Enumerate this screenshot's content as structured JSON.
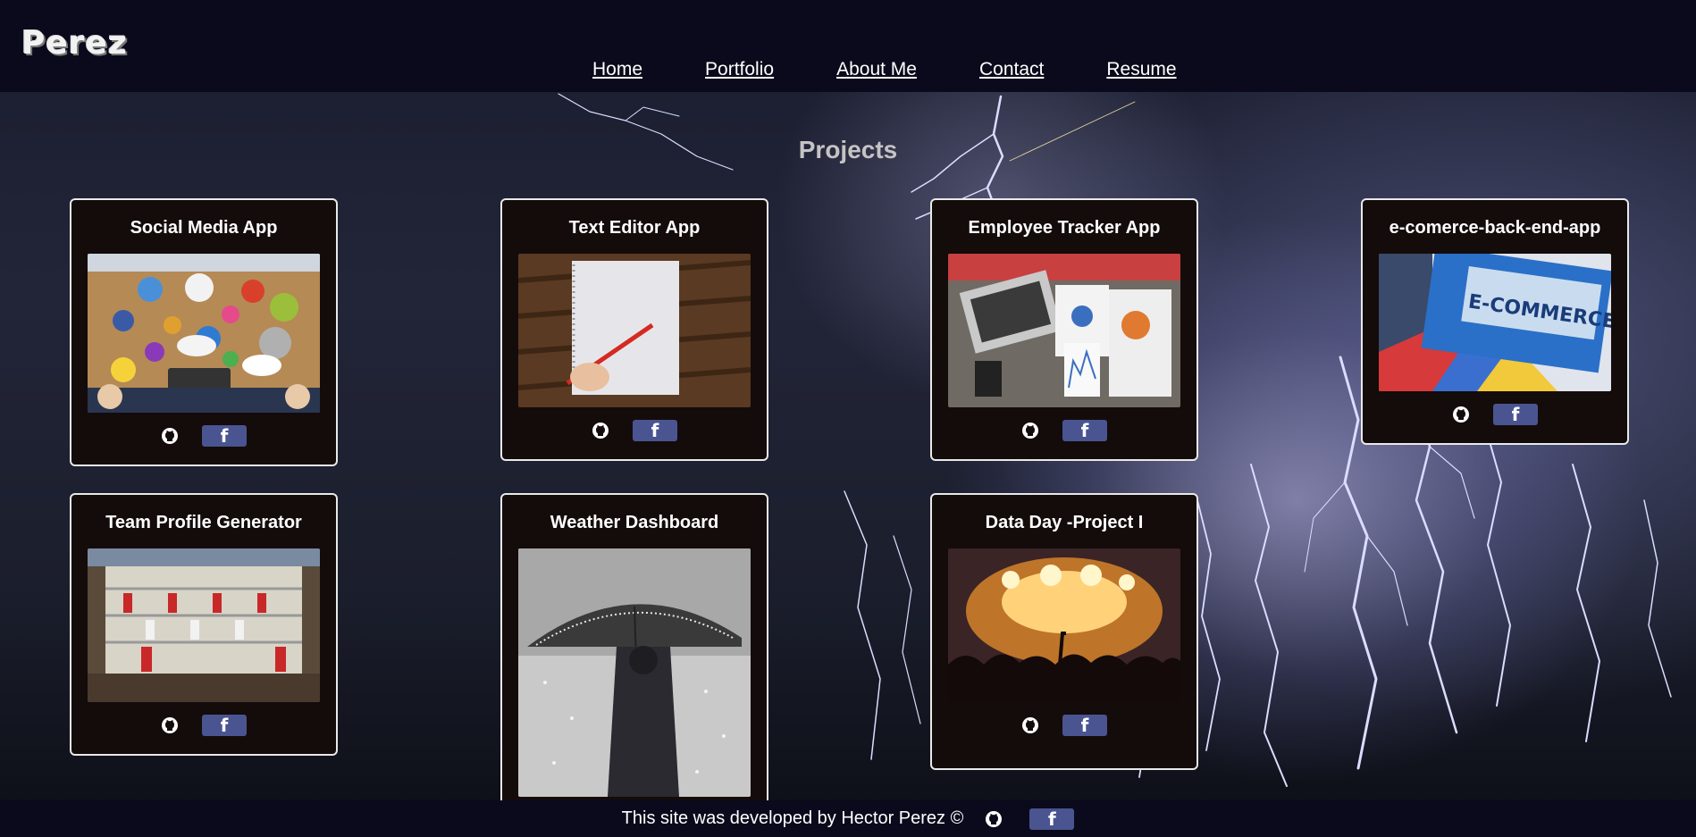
{
  "header": {
    "brand": "Perez",
    "nav": [
      "Home",
      "Portfolio",
      "About Me",
      "Contact",
      "Resume"
    ]
  },
  "main": {
    "heading": "Projects",
    "projects": [
      {
        "title": "Social Media App",
        "image": "social-media-photo"
      },
      {
        "title": "Text Editor App",
        "image": "notebook-pen-photo"
      },
      {
        "title": "Employee Tracker App",
        "image": "office-charts-photo"
      },
      {
        "title": "e-comerce-back-end-app",
        "image": "ecommerce-binder-photo"
      },
      {
        "title": "Team Profile Generator",
        "image": "foosball-photo"
      },
      {
        "title": "Weather Dashboard",
        "image": "umbrella-snow-photo"
      },
      {
        "title": "Data Day -Project I",
        "image": "concert-photo"
      }
    ],
    "icons": {
      "github": "github-icon",
      "facebook": "facebook-icon"
    },
    "facebook_glyph": "f"
  },
  "footer": {
    "text": "This site was developed by Hector Perez ©"
  },
  "colors": {
    "header_bg": "#0a0a1c",
    "card_bg": "#140b0b",
    "facebook_button": "#4a5490"
  }
}
